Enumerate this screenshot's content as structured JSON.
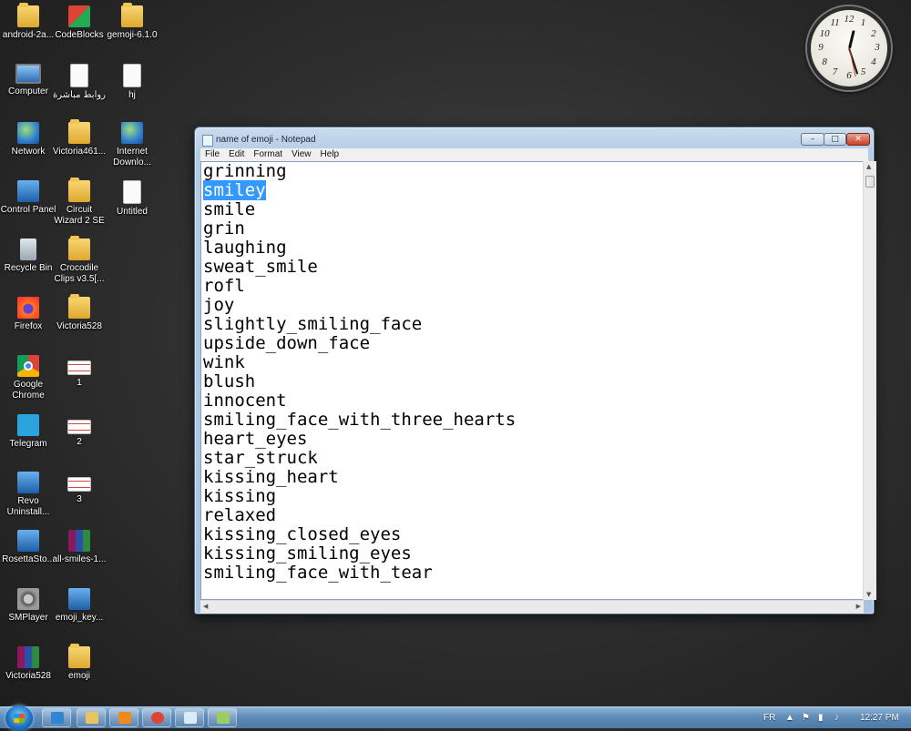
{
  "desktop": {
    "icons": [
      {
        "label": "android-2a...",
        "kind": "folder"
      },
      {
        "label": "CodeBlocks",
        "kind": "cb"
      },
      {
        "label": "gemoji-6.1.0",
        "kind": "folder"
      },
      {
        "label": "Computer",
        "kind": "monitor"
      },
      {
        "label": "روابط مباشرة",
        "kind": "doc"
      },
      {
        "label": "hj",
        "kind": "doc"
      },
      {
        "label": "Network",
        "kind": "globe"
      },
      {
        "label": "Victoria461...",
        "kind": "folder"
      },
      {
        "label": "Internet Downlo...",
        "kind": "globe"
      },
      {
        "label": "Control Panel",
        "kind": "blue"
      },
      {
        "label": "Circuit Wizard 2 SE",
        "kind": "folder"
      },
      {
        "label": "Untitled",
        "kind": "doc"
      },
      {
        "label": "Recycle Bin",
        "kind": "bin"
      },
      {
        "label": "Crocodile Clips v3.5[...",
        "kind": "folder"
      },
      {
        "label": "Firefox",
        "kind": "fox"
      },
      {
        "label": "Victoria528",
        "kind": "folder"
      },
      {
        "label": "Google Chrome",
        "kind": "chrome"
      },
      {
        "label": "1",
        "kind": "doc-lined"
      },
      {
        "label": "Telegram",
        "kind": "tg"
      },
      {
        "label": "2",
        "kind": "doc-lined"
      },
      {
        "label": "Revo Uninstall...",
        "kind": "blue"
      },
      {
        "label": "3",
        "kind": "doc-lined"
      },
      {
        "label": "RosettaSto...",
        "kind": "blue"
      },
      {
        "label": "all-smiles-1...",
        "kind": "rar"
      },
      {
        "label": "SMPlayer",
        "kind": "gear"
      },
      {
        "label": "emoji_key...",
        "kind": "blue"
      },
      {
        "label": "Victoria528",
        "kind": "rar"
      },
      {
        "label": "emoji",
        "kind": "folder"
      }
    ]
  },
  "clock": {
    "numbers": [
      "12",
      "1",
      "2",
      "3",
      "4",
      "5",
      "6",
      "7",
      "8",
      "9",
      "10",
      "11"
    ],
    "hour": 12,
    "minute": 27
  },
  "window": {
    "title": "name of emoji - Notepad",
    "controls": {
      "minimize": "–",
      "maximize": "□",
      "close": "✕"
    },
    "menu": [
      "File",
      "Edit",
      "Format",
      "View",
      "Help"
    ],
    "selected_line": 1,
    "lines": [
      "grinning",
      "smiley",
      "smile",
      "grin",
      "laughing",
      "sweat_smile",
      "rofl",
      "joy",
      "slightly_smiling_face",
      "upside_down_face",
      "wink",
      "blush",
      "innocent",
      "smiling_face_with_three_hearts",
      "heart_eyes",
      "star_struck",
      "kissing_heart",
      "kissing",
      "relaxed",
      "kissing_closed_eyes",
      "kissing_smiling_eyes",
      "smiling_face_with_tear"
    ]
  },
  "taskbar": {
    "language": "FR",
    "time": "12:27 PM",
    "pinned": [
      {
        "name": "internet-explorer",
        "color": "#2f86d6"
      },
      {
        "name": "file-explorer",
        "color": "#e8c560"
      },
      {
        "name": "media-player",
        "color": "#f08a1c"
      },
      {
        "name": "google-chrome",
        "color": "#db4437"
      },
      {
        "name": "notepad",
        "color": "#d9ecf7"
      },
      {
        "name": "paint",
        "color": "#9ccc65"
      }
    ]
  }
}
